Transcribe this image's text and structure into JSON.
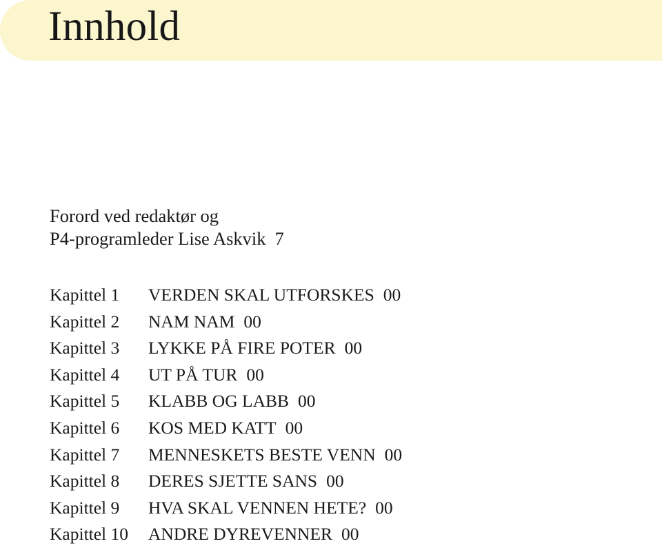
{
  "header": {
    "title": "Innhold",
    "banner_color": "#fbf6ce"
  },
  "foreword": {
    "line1": "Forord ved redaktør og",
    "line2": "P4-programleder Lise Askvik",
    "page": "7"
  },
  "toc": {
    "rows": [
      {
        "chapter": "Kapittel 1",
        "title": "VERDEN SKAL UTFORSKES",
        "page": "00"
      },
      {
        "chapter": "Kapittel 2",
        "title": "NAM NAM",
        "page": "00"
      },
      {
        "chapter": "Kapittel 3",
        "title": "LYKKE PÅ FIRE POTER",
        "page": "00"
      },
      {
        "chapter": "Kapittel 4",
        "title": "UT PÅ TUR",
        "page": "00"
      },
      {
        "chapter": "Kapittel 5",
        "title": "KLABB OG LABB",
        "page": "00"
      },
      {
        "chapter": "Kapittel 6",
        "title": "KOS MED KATT",
        "page": "00"
      },
      {
        "chapter": "Kapittel 7",
        "title": "MENNESKETS BESTE VENN",
        "page": "00"
      },
      {
        "chapter": "Kapittel 8",
        "title": "DERES SJETTE SANS",
        "page": "00"
      },
      {
        "chapter": "Kapittel 9",
        "title": "HVA SKAL VENNEN HETE?",
        "page": "00"
      },
      {
        "chapter": "Kapittel 10",
        "title": "ANDRE DYREVENNER",
        "page": "00"
      }
    ]
  },
  "colors": {
    "text": "#1a1a1a",
    "background": "#ffffff",
    "banner": "#fbf6ce"
  }
}
